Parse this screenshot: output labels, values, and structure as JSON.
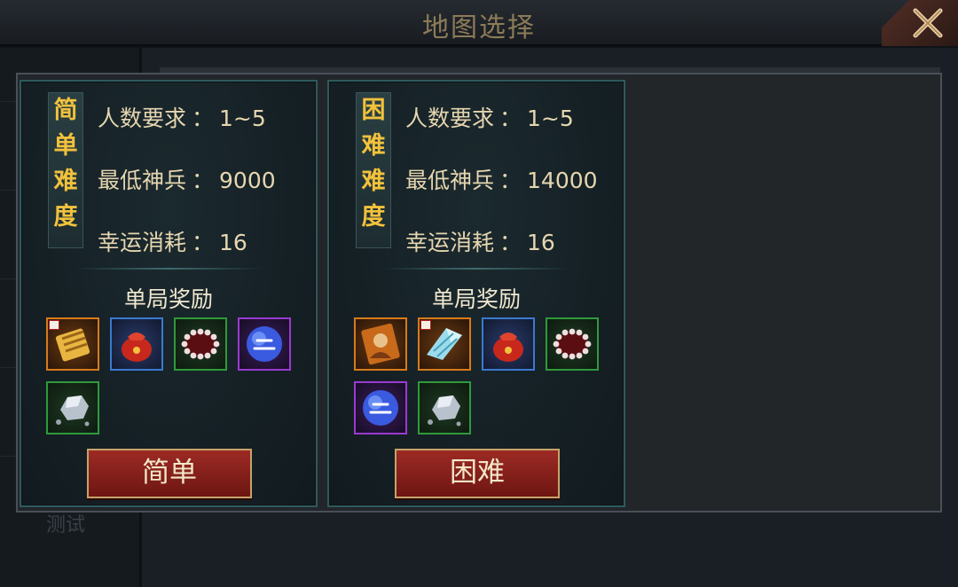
{
  "window": {
    "title": "地图选择"
  },
  "background": {
    "ghost_label": "测试"
  },
  "cards": [
    {
      "difficulty_chars": [
        "简",
        "单",
        "难",
        "度"
      ],
      "stats": [
        {
          "label": "人数要求",
          "sep": "：",
          "value": "1~5"
        },
        {
          "label": "最低神兵",
          "sep": "：",
          "value": "9000"
        },
        {
          "label": "幸运消耗",
          "sep": "：",
          "value": "16"
        }
      ],
      "reward_title": "单局奖励",
      "rewards": [
        {
          "icon": "golden-scroll-icon",
          "rarity": "orange",
          "badge": true
        },
        {
          "icon": "red-pouch-icon",
          "rarity": "blue",
          "badge": false
        },
        {
          "icon": "pearl-necklace-icon",
          "rarity": "green",
          "badge": false
        },
        {
          "icon": "blue-orb-icon",
          "rarity": "purple",
          "badge": false
        },
        {
          "icon": "silver-ore-icon",
          "rarity": "green",
          "badge": false
        }
      ],
      "button_label": "简单"
    },
    {
      "difficulty_chars": [
        "困",
        "难",
        "难",
        "度"
      ],
      "stats": [
        {
          "label": "人数要求",
          "sep": "：",
          "value": "1~5"
        },
        {
          "label": "最低神兵",
          "sep": "：",
          "value": "14000"
        },
        {
          "label": "幸运消耗",
          "sep": "：",
          "value": "16"
        }
      ],
      "reward_title": "单局奖励",
      "rewards": [
        {
          "icon": "hero-card-icon",
          "rarity": "orange",
          "badge": false
        },
        {
          "icon": "ice-shard-icon",
          "rarity": "orange",
          "badge": true
        },
        {
          "icon": "red-pouch-icon",
          "rarity": "blue",
          "badge": false
        },
        {
          "icon": "pearl-necklace-icon",
          "rarity": "green",
          "badge": false
        },
        {
          "icon": "blue-orb-icon",
          "rarity": "purple",
          "badge": false
        },
        {
          "icon": "silver-ore-icon",
          "rarity": "green",
          "badge": false
        }
      ],
      "button_label": "困难"
    }
  ],
  "colors": {
    "difficulty_text": "#f2c23c",
    "card_border": "#2f5a5c",
    "button_bg": "#8a2019",
    "rarity_orange": "#d97a1a",
    "rarity_blue": "#3a7ad0",
    "rarity_green": "#2f9a3a",
    "rarity_purple": "#9a3ad0"
  }
}
